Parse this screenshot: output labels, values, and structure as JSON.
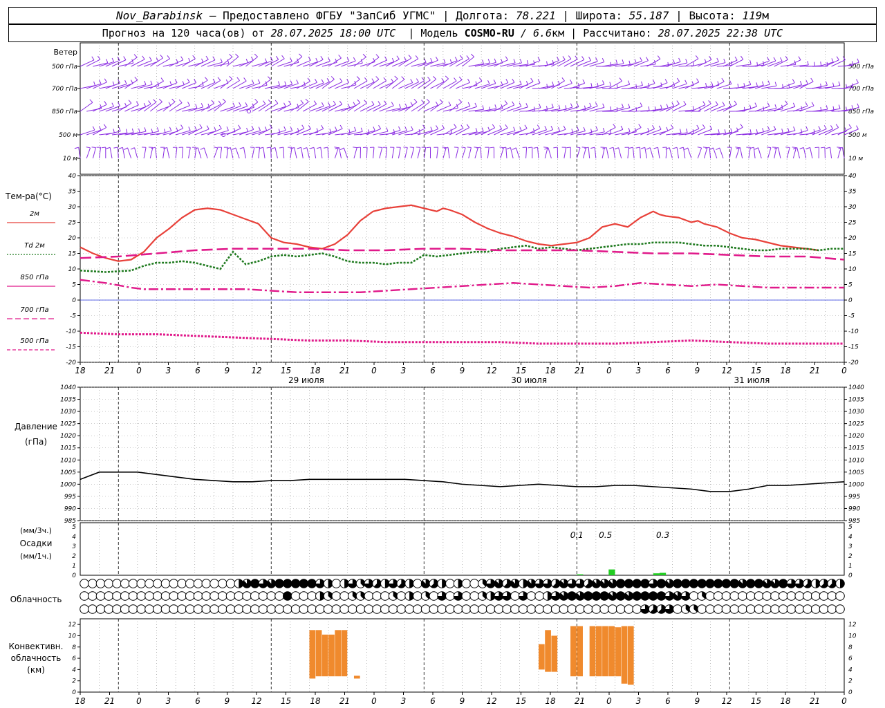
{
  "header": {
    "station": "Nov_Barabinsk",
    "dash": "—",
    "provided_by": "Предоставлено ФГБУ \"ЗапСиб УГМС\"",
    "lon_label": "Долгота:",
    "lon_value": "78.221",
    "lat_label": "Широта:",
    "lat_value": "55.187",
    "alt_label": "Высота:",
    "alt_value": "119",
    "alt_unit": "м",
    "forecast_prefix": "Прогноз на 120 часа(ов) от",
    "forecast_from": "28.07.2025 18:00 UTC",
    "model_label": "Модель",
    "model_name": "COSMO-RU",
    "model_res": "/ 6.6",
    "model_res_unit": "км",
    "calc_label": "Рассчитано:",
    "calc_time": "28.07.2025 22:38 UTC"
  },
  "chart_data": {
    "type": "meteogram",
    "hour_labels": [
      "18",
      "21",
      "0",
      "3",
      "6",
      "9",
      "12",
      "15",
      "18",
      "21",
      "0",
      "3",
      "6",
      "9",
      "12",
      "15",
      "18",
      "21",
      "0",
      "3",
      "6",
      "9",
      "12",
      "15",
      "18",
      "21",
      "0"
    ],
    "day_labels": [
      "29 июля",
      "30 июля",
      "31 июля"
    ],
    "wind": {
      "title": "Ветер",
      "levels": [
        "500 гПа",
        "700 гПа",
        "850 гПа",
        "500 м",
        "10 м"
      ]
    },
    "temperature": {
      "title": "Тем-ра(°C)",
      "ylim": [
        -20,
        40
      ],
      "ticks": [
        40,
        35,
        30,
        25,
        20,
        15,
        10,
        5,
        0,
        -5,
        -10,
        -15,
        -20
      ],
      "legend": [
        {
          "label": "2м",
          "color": "#e8413a",
          "style": "solid"
        },
        {
          "label": "Td  2м",
          "color": "#1f7a1f",
          "style": "dotted"
        },
        {
          "label": "850 гПа",
          "color": "#e0198a",
          "style": "solid"
        },
        {
          "label": "700 гПа",
          "color": "#e0198a",
          "style": "dashed"
        },
        {
          "label": "500 гПа",
          "color": "#e0198a",
          "style": "dash"
        }
      ],
      "series": [
        {
          "name": "2м",
          "color": "#e8413a",
          "dash": "",
          "width": 2.2,
          "x": [
            0,
            2,
            4,
            6,
            8,
            10,
            12,
            14,
            16,
            18,
            20,
            22,
            24,
            26,
            28,
            30,
            32,
            34,
            36,
            38,
            40,
            42,
            44,
            46,
            48,
            50,
            52,
            54,
            56,
            57,
            58,
            60,
            62,
            64,
            66,
            68,
            70,
            72,
            74,
            76,
            78,
            80,
            82,
            84,
            86,
            88,
            90,
            91,
            92,
            94,
            96,
            97,
            98,
            100,
            102,
            104,
            106,
            108,
            110,
            112,
            114,
            116,
            118,
            120
          ],
          "y": [
            17,
            15,
            13.5,
            12.5,
            13,
            15.5,
            20,
            23,
            26.5,
            29,
            29.5,
            29,
            27.5,
            26,
            24.5,
            20,
            18.5,
            18,
            17,
            16.5,
            18,
            21,
            25.5,
            28.5,
            29.5,
            30,
            30.5,
            29.5,
            28.5,
            29.5,
            29,
            27.5,
            25,
            23,
            21.5,
            20.5,
            19,
            18,
            17.5,
            18,
            18.5,
            20,
            23.5,
            24.5,
            23.5,
            26.5,
            28.5,
            27.5,
            27,
            26.5,
            25,
            25.5,
            24.5,
            23.5,
            21.5,
            20,
            19.5,
            18.5,
            17.5,
            17,
            16.5,
            16
          ]
        },
        {
          "name": "Td 2м",
          "color": "#1f7a1f",
          "dash": "3,2",
          "width": 2.6,
          "x": [
            0,
            4,
            8,
            10,
            12,
            14,
            16,
            18,
            20,
            22,
            24,
            26,
            28,
            30,
            32,
            34,
            36,
            38,
            40,
            42,
            44,
            46,
            48,
            50,
            52,
            54,
            56,
            58,
            60,
            62,
            64,
            66,
            68,
            70,
            72,
            74,
            76,
            78,
            80,
            82,
            84,
            86,
            88,
            90,
            92,
            94,
            96,
            98,
            100,
            102,
            104,
            106,
            108,
            110,
            112,
            114,
            116,
            118,
            120
          ],
          "y": [
            9.5,
            9,
            9.5,
            11,
            12,
            12,
            12.5,
            12,
            11,
            10,
            15.5,
            11.5,
            12.5,
            14,
            14.5,
            14,
            14.5,
            15,
            14,
            12.5,
            12,
            12,
            11.5,
            12,
            12,
            14.5,
            14,
            14.5,
            15,
            15.5,
            15.5,
            16.5,
            17,
            17.5,
            16.5,
            17,
            16.5,
            16,
            16.5,
            17,
            17.5,
            18,
            18,
            18.5,
            18.5,
            18.5,
            18,
            17.5,
            17.5,
            17,
            16.5,
            16,
            16,
            16.5,
            16.5,
            16.5,
            16,
            16.5,
            16.5
          ]
        },
        {
          "name": "850 гПа",
          "color": "#e0198a",
          "dash": "16,6",
          "width": 2.6,
          "x": [
            0,
            6,
            12,
            18,
            24,
            30,
            36,
            42,
            48,
            54,
            60,
            66,
            72,
            78,
            84,
            90,
            96,
            102,
            108,
            114,
            120
          ],
          "y": [
            13.5,
            14,
            15,
            16,
            16.5,
            16.5,
            16.5,
            16,
            16,
            16.5,
            16.5,
            16,
            16,
            16,
            15.5,
            15,
            15,
            14.5,
            14,
            14,
            13
          ]
        },
        {
          "name": "700 гПа",
          "color": "#e0198a",
          "dash": "14,4,3,4",
          "width": 2.4,
          "x": [
            0,
            4,
            8,
            10,
            14,
            18,
            22,
            26,
            30,
            34,
            36,
            40,
            44,
            48,
            52,
            56,
            60,
            64,
            68,
            72,
            76,
            80,
            84,
            88,
            92,
            96,
            100,
            104,
            108,
            112,
            116,
            120
          ],
          "y": [
            6.5,
            5.5,
            4,
            3.5,
            3.5,
            3.5,
            3.5,
            3.5,
            3,
            2.5,
            2.5,
            2.5,
            2.5,
            3,
            3.5,
            4,
            4.5,
            5,
            5.5,
            5,
            4.5,
            4,
            4.5,
            5.5,
            5,
            4.5,
            5,
            4.5,
            4,
            4,
            4,
            4
          ]
        },
        {
          "name": "500 гПа",
          "color": "#e0198a",
          "dash": "3,2",
          "width": 3,
          "x": [
            0,
            6,
            12,
            18,
            24,
            30,
            36,
            42,
            48,
            54,
            60,
            66,
            72,
            78,
            84,
            90,
            96,
            102,
            108,
            114,
            120
          ],
          "y": [
            -10.5,
            -11,
            -11,
            -11.5,
            -12,
            -12.5,
            -13,
            -13,
            -13.5,
            -13.5,
            -13.5,
            -13.5,
            -14,
            -14,
            -14,
            -13.5,
            -13,
            -13.5,
            -14,
            -14,
            -14
          ]
        }
      ]
    },
    "pressure": {
      "title": "Давление",
      "unit": "(гПа)",
      "ylim": [
        985,
        1040
      ],
      "ticks": [
        1040,
        1035,
        1030,
        1025,
        1020,
        1015,
        1010,
        1005,
        1000,
        995,
        990,
        985
      ],
      "x": [
        0,
        3,
        6,
        9,
        12,
        15,
        18,
        21,
        24,
        27,
        30,
        33,
        36,
        39,
        42,
        45,
        48,
        51,
        54,
        57,
        60,
        63,
        66,
        69,
        72,
        75,
        78,
        81,
        84,
        87,
        90,
        93,
        96,
        99,
        102,
        105,
        108,
        111,
        114,
        117,
        120
      ],
      "y": [
        1002,
        1005,
        1005,
        1005,
        1004,
        1003,
        1002,
        1001.5,
        1001,
        1001,
        1001.5,
        1001.5,
        1002,
        1002,
        1002,
        1002,
        1002,
        1002,
        1001.5,
        1001,
        1000,
        999.5,
        999,
        999.5,
        1000,
        999.5,
        999,
        999,
        999.5,
        999.5,
        999,
        998.5,
        998,
        997,
        997,
        998,
        999.5,
        999.5,
        1000,
        1000.5,
        1001
      ]
    },
    "precipitation": {
      "title": "Осадки",
      "unit_top": "(мм/3ч.)",
      "unit_bottom": "(мм/1ч.)",
      "ylim": [
        0,
        5
      ],
      "ticks": [
        5,
        4,
        3,
        2,
        1,
        0
      ],
      "labels": [
        {
          "hour": 78,
          "text": "0.1"
        },
        {
          "hour": 82.5,
          "text": "0.5"
        },
        {
          "hour": 91.5,
          "text": "0.3"
        }
      ],
      "bars": [
        {
          "hour": 78,
          "value": 0.1
        },
        {
          "hour": 83,
          "value": 0.6
        },
        {
          "hour": 90,
          "value": 0.2
        },
        {
          "hour": 91,
          "value": 0.25
        }
      ],
      "color": "#22cc22"
    },
    "cloudiness": {
      "title": "Облачность",
      "rows": {
        "top": [
          0,
          0,
          0,
          0,
          0,
          0,
          0,
          0,
          0,
          0,
          0,
          0,
          0,
          0,
          0,
          0,
          0,
          0,
          0,
          4,
          7,
          8,
          6,
          7,
          8,
          8,
          8,
          8,
          8,
          6,
          4,
          0,
          4,
          6,
          3,
          6,
          5,
          4,
          6,
          5,
          4,
          0,
          7,
          5,
          4,
          0,
          4,
          0,
          0,
          3,
          6,
          7,
          5,
          7,
          4,
          7,
          6,
          6,
          5,
          7,
          6,
          6,
          5,
          7,
          7,
          7,
          8,
          8,
          8,
          8,
          6,
          8,
          7,
          8,
          8,
          8,
          8,
          8,
          8,
          8,
          8,
          7,
          8,
          8,
          7,
          7,
          8,
          6,
          6,
          5,
          4,
          5,
          5,
          4
        ],
        "mid": [
          0,
          0,
          0,
          0,
          0,
          0,
          0,
          0,
          0,
          0,
          0,
          0,
          0,
          0,
          0,
          0,
          0,
          0,
          0,
          0,
          0,
          0,
          0,
          0,
          0,
          8,
          0,
          0,
          0,
          4,
          3,
          0,
          0,
          3,
          3,
          0,
          0,
          0,
          3,
          0,
          4,
          0,
          3,
          0,
          6,
          0,
          6,
          0,
          0,
          3,
          4,
          6,
          6,
          0,
          6,
          0,
          0,
          4,
          6,
          7,
          8,
          7,
          8,
          8,
          8,
          7,
          8,
          7,
          8,
          8,
          8,
          8,
          6,
          7,
          6,
          0,
          3,
          0,
          0,
          0,
          0,
          0,
          0,
          0,
          0,
          0,
          0,
          0,
          0,
          0,
          0,
          0,
          0,
          0
        ],
        "low": [
          0,
          0,
          0,
          0,
          0,
          0,
          0,
          0,
          0,
          0,
          0,
          0,
          0,
          0,
          0,
          0,
          0,
          0,
          0,
          0,
          0,
          0,
          0,
          0,
          0,
          0,
          0,
          0,
          0,
          0,
          0,
          0,
          0,
          0,
          0,
          0,
          0,
          0,
          0,
          0,
          0,
          0,
          0,
          0,
          0,
          0,
          0,
          0,
          0,
          0,
          0,
          0,
          0,
          0,
          0,
          0,
          0,
          0,
          0,
          0,
          0,
          0,
          0,
          0,
          0,
          0,
          0,
          0,
          0,
          6,
          5,
          5,
          6,
          0,
          3,
          3,
          0,
          0,
          0,
          0,
          0,
          0,
          0,
          0,
          0,
          0,
          0,
          0,
          0,
          0,
          0,
          0,
          0,
          0
        ]
      }
    },
    "convective": {
      "title_lines": [
        "Конвективн.",
        "облачность",
        "(км)"
      ],
      "ylim": [
        0,
        13
      ],
      "ticks": [
        12,
        10,
        8,
        6,
        4,
        2,
        0
      ],
      "color": "#f08a2d",
      "bars": [
        {
          "from": 36,
          "to": 37,
          "base": 2.4,
          "top": 11
        },
        {
          "from": 37,
          "to": 38,
          "base": 2.8,
          "top": 11
        },
        {
          "from": 38,
          "to": 39,
          "base": 2.8,
          "top": 10.2
        },
        {
          "from": 39,
          "to": 40,
          "base": 2.8,
          "top": 10.2
        },
        {
          "from": 40,
          "to": 41,
          "base": 2.8,
          "top": 11
        },
        {
          "from": 41,
          "to": 42,
          "base": 2.8,
          "top": 11
        },
        {
          "from": 43,
          "to": 44,
          "base": 2.4,
          "top": 2.9
        },
        {
          "from": 72,
          "to": 73,
          "base": 4.0,
          "top": 8.5
        },
        {
          "from": 73,
          "to": 74,
          "base": 3.6,
          "top": 11
        },
        {
          "from": 74,
          "to": 75,
          "base": 3.6,
          "top": 10
        },
        {
          "from": 77,
          "to": 78,
          "base": 2.8,
          "top": 11.7
        },
        {
          "from": 78,
          "to": 79,
          "base": 2.8,
          "top": 11.7
        },
        {
          "from": 80,
          "to": 81,
          "base": 2.8,
          "top": 11.7
        },
        {
          "from": 81,
          "to": 82,
          "base": 2.8,
          "top": 11.7
        },
        {
          "from": 82,
          "to": 83,
          "base": 2.8,
          "top": 11.7
        },
        {
          "from": 83,
          "to": 84,
          "base": 2.8,
          "top": 11.7
        },
        {
          "from": 84,
          "to": 85,
          "base": 2.8,
          "top": 11.5
        },
        {
          "from": 85,
          "to": 86,
          "base": 1.5,
          "top": 11.7
        },
        {
          "from": 86,
          "to": 87,
          "base": 1.3,
          "top": 11.7
        }
      ]
    },
    "colors": {
      "wind": "#8a2be2",
      "pressure": "#000000",
      "zero_line": "#2233dd",
      "temp_2m": "#e8413a",
      "dewpoint": "#1f7a1f",
      "upper_temp": "#e0198a"
    }
  }
}
